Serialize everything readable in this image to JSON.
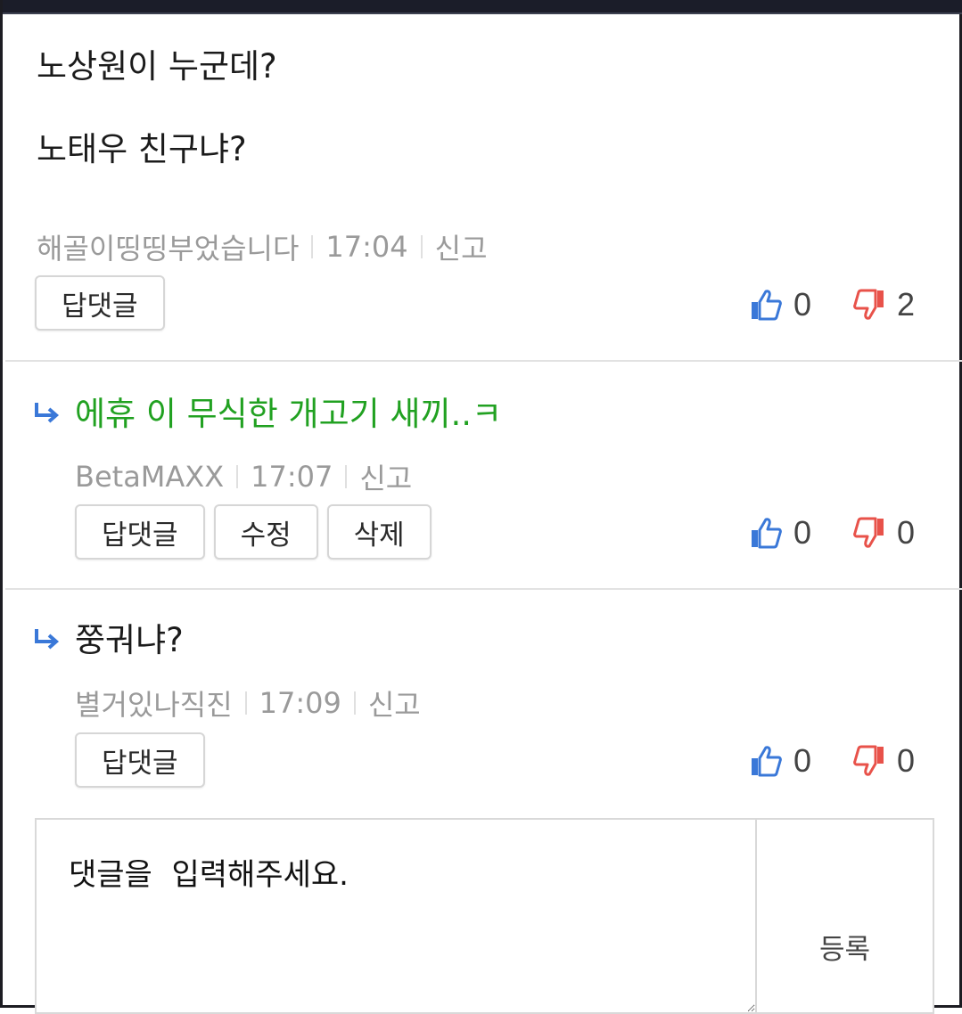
{
  "comments": [
    {
      "text": "노상원이 누군데?\n\n노태우 친구냐?",
      "author": "해골이띵띵부었습니다",
      "time": "17:04",
      "report": "신고",
      "buttons": [
        "답댓글"
      ],
      "likes": "0",
      "dislikes": "2",
      "is_reply": false
    },
    {
      "text": "에휴 이 무식한 개고기 새끼..ㅋ",
      "author": "BetaMAXX",
      "time": "17:07",
      "report": "신고",
      "buttons": [
        "답댓글",
        "수정",
        "삭제"
      ],
      "likes": "0",
      "dislikes": "0",
      "is_reply": true,
      "highlight_color": "#21a121"
    },
    {
      "text": "쭝궈냐?",
      "author": "별거있나직진",
      "time": "17:09",
      "report": "신고",
      "buttons": [
        "답댓글"
      ],
      "likes": "0",
      "dislikes": "0",
      "is_reply": true
    }
  ],
  "composer": {
    "placeholder": "댓글을  입력해주세요.",
    "submit_label": "등록"
  },
  "icons": {
    "reply": "reply-arrow-icon",
    "like": "thumbs-up-icon",
    "dislike": "thumbs-down-icon"
  },
  "colors": {
    "like": "#3a78d8",
    "dislike": "#e8524a",
    "reply_arrow": "#3a78d8"
  }
}
